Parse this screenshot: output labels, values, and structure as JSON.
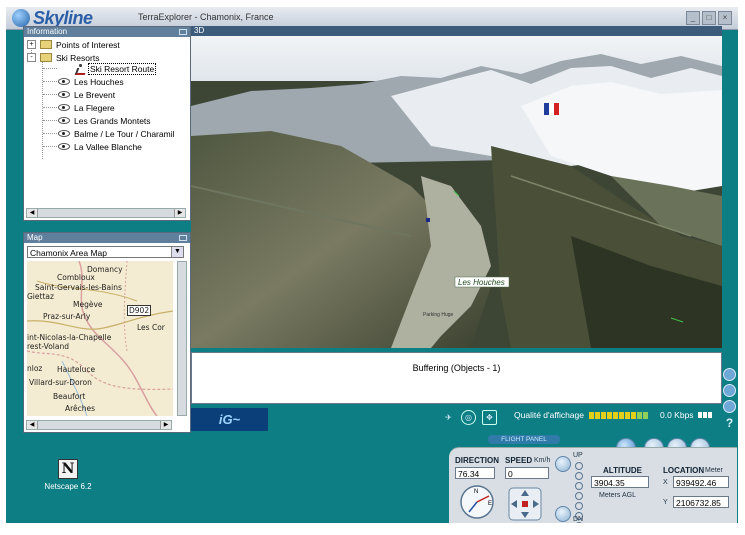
{
  "window": {
    "brand": "Skyline",
    "title": "TerraExplorer - Chamonix, France",
    "controls": [
      "minimize",
      "maximize",
      "close"
    ]
  },
  "information_panel": {
    "title": "Information",
    "tree": [
      {
        "label": "Points of Interest",
        "type": "folder",
        "expander": "+"
      },
      {
        "label": "Ski Resorts",
        "type": "folder",
        "expander": "-"
      },
      {
        "label": "Ski Resort Route",
        "type": "route",
        "selected": true
      },
      {
        "label": "Les Houches",
        "type": "location"
      },
      {
        "label": "Le Brevent",
        "type": "location"
      },
      {
        "label": "La Flegere",
        "type": "location"
      },
      {
        "label": "Les Grands Montets",
        "type": "location"
      },
      {
        "label": "Balme / Le Tour / Charamil",
        "type": "location"
      },
      {
        "label": "La Vallee Blanche",
        "type": "location"
      }
    ]
  },
  "map_panel": {
    "title": "Map",
    "selected_map": "Chamonix Area Map",
    "labels": [
      "Domancy",
      "Combloux",
      "Saint-Gervais-les-Bains",
      "Giettaz",
      "Megève",
      "D902",
      "Praz-sur-Arly",
      "Les Cor",
      "int-Nicolas-la-Chapelle",
      "rest-Voland",
      "Hauteluce",
      "nloz",
      "Villard-sur-Doron",
      "Beaufort",
      "Arêches"
    ]
  },
  "view3d": {
    "title": "3D",
    "place_label": "Les Houches",
    "small_label": "Parking Huge"
  },
  "status": {
    "message": "Buffering (Objects - 1)"
  },
  "toolbar": {
    "logo": "iG~",
    "quality_label": "Qualité d'affichage",
    "bandwidth": "0.0 Kbps",
    "help": "?"
  },
  "flight_panel": {
    "label": "FLIGHT PANEL",
    "direction_label": "DIRECTION",
    "direction_value": "76.34",
    "speed_label": "SPEED",
    "speed_unit": "Km/h",
    "speed_value": "0",
    "up_label": "UP",
    "down_label": "DN",
    "altitude_label": "ALTITUDE",
    "altitude_value": "3904.35",
    "altitude_mode": "Meters AGL",
    "location_label": "LOCATION",
    "location_unit": "Meter",
    "x_label": "X",
    "x_value": "939492.46",
    "y_label": "Y",
    "y_value": "2106732.85",
    "compass_letters": [
      "N",
      "E"
    ]
  },
  "desktop": {
    "icon_label": "Netscape 6.2",
    "icon_glyph": "N"
  },
  "colors": {
    "app_background": "#0c7e84",
    "panel_header": "#5f7f9c",
    "view_header": "#3d5c7c"
  }
}
